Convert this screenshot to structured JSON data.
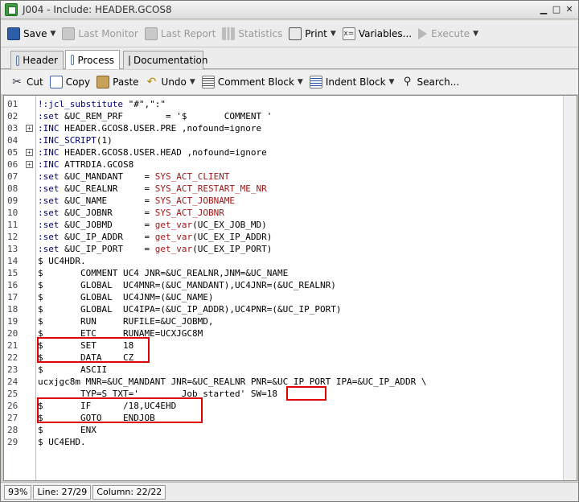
{
  "window": {
    "title": "J004 - Include: HEADER.GCOS8"
  },
  "toolbar": {
    "save": "Save",
    "last_monitor": "Last Monitor",
    "last_report": "Last Report",
    "statistics": "Statistics",
    "print": "Print",
    "variables": "Variables...",
    "execute": "Execute"
  },
  "tabs": {
    "header": "Header",
    "process": "Process",
    "documentation": "Documentation"
  },
  "edit_toolbar": {
    "cut": "Cut",
    "copy": "Copy",
    "paste": "Paste",
    "undo": "Undo",
    "comment_block": "Comment Block",
    "indent_block": "Indent Block",
    "search": "Search..."
  },
  "code_lines": [
    {
      "n": "01",
      "t": "!:jcl_substitute \"#\",\":\""
    },
    {
      "n": "02",
      "t": ":set &UC_REM_PRF        = '$       COMMENT '"
    },
    {
      "n": "03",
      "t": ":INC HEADER.GCOS8.USER.PRE ,nofound=ignore"
    },
    {
      "n": "04",
      "t": ":INC_SCRIPT(1)"
    },
    {
      "n": "05",
      "t": ":INC HEADER.GCOS8.USER.HEAD ,nofound=ignore"
    },
    {
      "n": "06",
      "t": ":INC ATTRDIA.GCOS8"
    },
    {
      "n": "07",
      "t": ":set &UC_MANDANT    = SYS_ACT_CLIENT"
    },
    {
      "n": "08",
      "t": ":set &UC_REALNR     = SYS_ACT_RESTART_ME_NR"
    },
    {
      "n": "09",
      "t": ":set &UC_NAME       = SYS_ACT_JOBNAME"
    },
    {
      "n": "10",
      "t": ":set &UC_JOBNR      = SYS_ACT_JOBNR"
    },
    {
      "n": "11",
      "t": ":set &UC_JOBMD      = get_var(UC_EX_JOB_MD)"
    },
    {
      "n": "12",
      "t": ":set &UC_IP_ADDR    = get_var(UC_EX_IP_ADDR)"
    },
    {
      "n": "13",
      "t": ":set &UC_IP_PORT    = get_var(UC_EX_IP_PORT)"
    },
    {
      "n": "14",
      "t": "$ UC4HDR."
    },
    {
      "n": "15",
      "t": "$       COMMENT UC4 JNR=&UC_REALNR,JNM=&UC_NAME"
    },
    {
      "n": "16",
      "t": "$       GLOBAL  UC4MNR=(&UC_MANDANT),UC4JNR=(&UC_REALNR)"
    },
    {
      "n": "17",
      "t": "$       GLOBAL  UC4JNM=(&UC_NAME)"
    },
    {
      "n": "18",
      "t": "$       GLOBAL  UC4IPA=(&UC_IP_ADDR),UC4PNR=(&UC_IP_PORT)"
    },
    {
      "n": "19",
      "t": "$       RUN     RUFILE=&UC_JOBMD,"
    },
    {
      "n": "20",
      "t": "$       ETC     RUNAME=UCXJGC8M"
    },
    {
      "n": "21",
      "t": "$       SET     18"
    },
    {
      "n": "22",
      "t": "$       DATA    CZ"
    },
    {
      "n": "23",
      "t": "$       ASCII"
    },
    {
      "n": "24",
      "t": "ucxjgc8m MNR=&UC_MANDANT JNR=&UC_REALNR PNR=&UC_IP_PORT IPA=&UC_IP_ADDR \\"
    },
    {
      "n": "25",
      "t": "        TYP=S TXT='        Job started' SW=18"
    },
    {
      "n": "26",
      "t": "$       IF      /18,UC4EHD"
    },
    {
      "n": "27",
      "t": "$       GOTO    ENDJOB"
    },
    {
      "n": "28",
      "t": "$       ENX"
    },
    {
      "n": "29",
      "t": "$ UC4EHD."
    }
  ],
  "status": {
    "zoom": "93%",
    "line": "Line: 27/29",
    "column": "Column: 22/22"
  }
}
